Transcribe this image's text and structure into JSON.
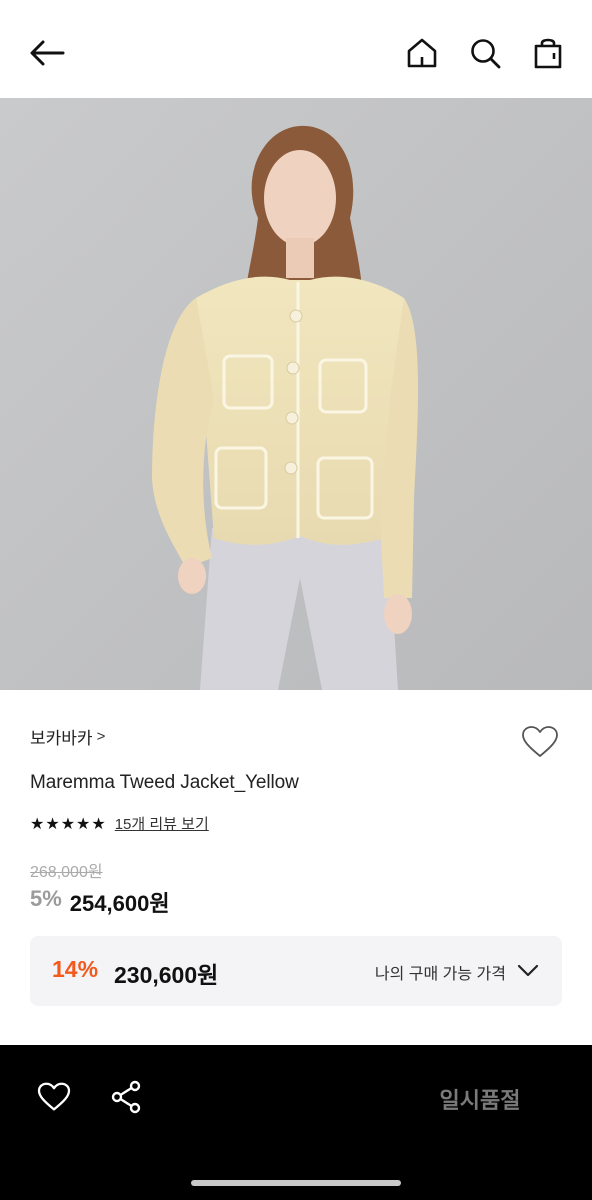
{
  "header": {
    "back_icon": "arrow-left-icon",
    "home_icon": "home-icon",
    "search_icon": "search-icon",
    "cart_icon": "shopping-bag-icon"
  },
  "hero": {
    "image_description": "model-wearing-jacket",
    "carousel_progress": 0.33
  },
  "product": {
    "brand": "보카바카",
    "brand_chevron": ">",
    "name": "Maremma Tweed Jacket_Yellow",
    "stars": "★★★★★",
    "review_link": "15개 리뷰 보기",
    "original_price": "268,000원",
    "discount_rate": "5%",
    "sale_price": "254,600원",
    "wish_icon": "heart-outline-icon"
  },
  "my_price": {
    "discount_rate": "14%",
    "price": "230,600원",
    "label": "나의 구매 가능 가격",
    "chevron_icon": "chevron-down-icon"
  },
  "bottom_bar": {
    "like_icon": "heart-outline-icon",
    "share_icon": "share-icon",
    "status_button": "일시품절"
  },
  "colors": {
    "accent_orange": "#f25a1d",
    "discount_gray": "#9b9b9b",
    "bar_black": "#000000"
  }
}
